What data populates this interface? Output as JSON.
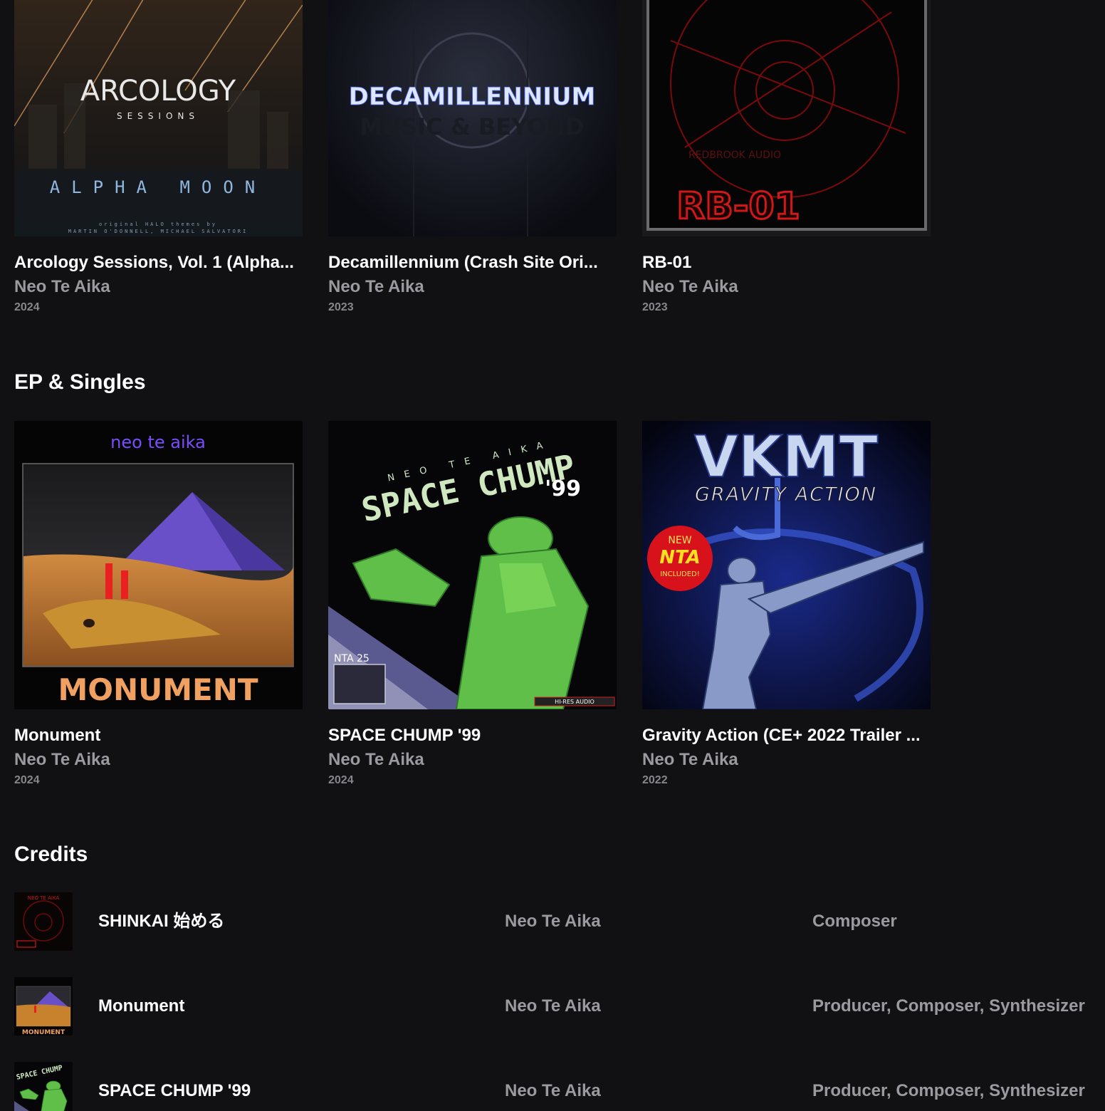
{
  "albums": [
    {
      "title": "Arcology Sessions, Vol. 1 (Alpha...",
      "artist": "Neo Te Aika",
      "year": "2024",
      "cover": {
        "main": "ARCOLOGY",
        "sub": "SESSIONS",
        "line": "ALPHA MOON",
        "small1": "original HALO themes by",
        "small2": "MARTIN O'DONNELL, MICHAEL SALVATORI"
      }
    },
    {
      "title": "Decamillennium (Crash Site Ori...",
      "artist": "Neo Te Aika",
      "year": "2023",
      "cover": {
        "main": "DECAMILLENNIUM",
        "sub": "MUSIC & BEYOND"
      }
    },
    {
      "title": "RB-01",
      "artist": "Neo Te Aika",
      "year": "2023",
      "cover": {
        "main": "RB-01",
        "sub": "REDBROOK AUDIO"
      }
    }
  ],
  "sections": {
    "singles": "EP & Singles",
    "credits": "Credits"
  },
  "singles": [
    {
      "title": "Monument",
      "artist": "Neo Te Aika",
      "year": "2024",
      "cover": {
        "top": "neo te aika",
        "main": "MONUMENT"
      }
    },
    {
      "title": "SPACE CHUMP '99",
      "artist": "Neo Te Aika",
      "year": "2024",
      "cover": {
        "top": "NEO TE AIKA",
        "main": "SPACE CHUMP",
        "num": "'99",
        "badge": "NTA 25",
        "hires": "HI-RES AUDIO"
      }
    },
    {
      "title": "Gravity Action (CE+ 2022 Trailer ...",
      "artist": "Neo Te Aika",
      "year": "2022",
      "cover": {
        "main": "VKMT",
        "sub": "GRAVITY ACTION",
        "sticker1": "NEW",
        "sticker2": "NTA",
        "sticker3": "INCLUDED!"
      }
    }
  ],
  "credits": [
    {
      "title": "SHINKAI 始める",
      "artist": "Neo Te Aika",
      "role": "Composer",
      "thumb_text": "NEO TE AIKA"
    },
    {
      "title": "Monument",
      "artist": "Neo Te Aika",
      "role": "Producer, Composer, Synthesizer",
      "thumb_text": "MONUMENT"
    },
    {
      "title": "SPACE CHUMP '99",
      "artist": "Neo Te Aika",
      "role": "Producer, Composer, Synthesizer",
      "thumb_text": "SPACE CHUMP"
    }
  ]
}
